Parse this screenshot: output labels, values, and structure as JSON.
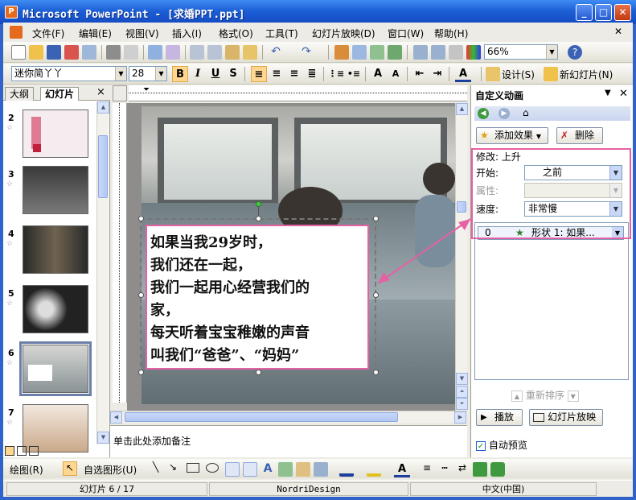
{
  "window": {
    "title": "Microsoft PowerPoint - [求婚PPT.ppt]",
    "app_icon_letter": "P"
  },
  "menu": [
    "文件(F)",
    "编辑(E)",
    "视图(V)",
    "插入(I)",
    "格式(O)",
    "工具(T)",
    "幻灯片放映(D)",
    "窗口(W)",
    "帮助(H)"
  ],
  "toolbar": {
    "zoom": "66%"
  },
  "format": {
    "font": "迷你简丫丫",
    "size": "28",
    "bold": "B",
    "italic": "I",
    "underline": "U",
    "shadow": "S",
    "design": "设计(S)",
    "new_slide": "新幻灯片(N)"
  },
  "left_pane": {
    "tabs": [
      "大纲",
      "幻灯片"
    ],
    "close": "×",
    "slides": [
      {
        "num": "2",
        "star": "☆"
      },
      {
        "num": "3",
        "star": "☆"
      },
      {
        "num": "4",
        "star": "☆"
      },
      {
        "num": "5",
        "star": "☆"
      },
      {
        "num": "6",
        "star": "☆",
        "selected": true
      },
      {
        "num": "7",
        "star": "☆"
      }
    ]
  },
  "slide": {
    "text_lines": [
      "如果当我29岁时，",
      "我们还在一起，",
      "我们一起用心经营我们的",
      "家，",
      "每天听着宝宝稚嫩的声音",
      "叫我们“爸爸”、“妈妈”"
    ]
  },
  "notes": {
    "placeholder": "单击此处添加备注"
  },
  "task_pane": {
    "title": "自定义动画",
    "add_effect": "添加效果",
    "remove": "删除",
    "modify": "修改: 上升",
    "start_label": "开始:",
    "start_value": "之前",
    "property_label": "属性:",
    "speed_label": "速度:",
    "speed_value": "非常慢",
    "list_item": {
      "index": "0",
      "text": "形状 1: 如果..."
    },
    "reorder": "重新排序",
    "play": "播放",
    "slideshow": "幻灯片放映",
    "autopreview": "自动预览"
  },
  "drawing": {
    "draw": "绘图(R)",
    "autoshape": "自选图形(U)"
  },
  "status": {
    "slide": "幻灯片 6 / 17",
    "design": "NordriDesign",
    "language": "中文(中国)"
  },
  "colors": {
    "accent_pink": "#e661a4",
    "xp_blue": "#1c5fd6"
  }
}
